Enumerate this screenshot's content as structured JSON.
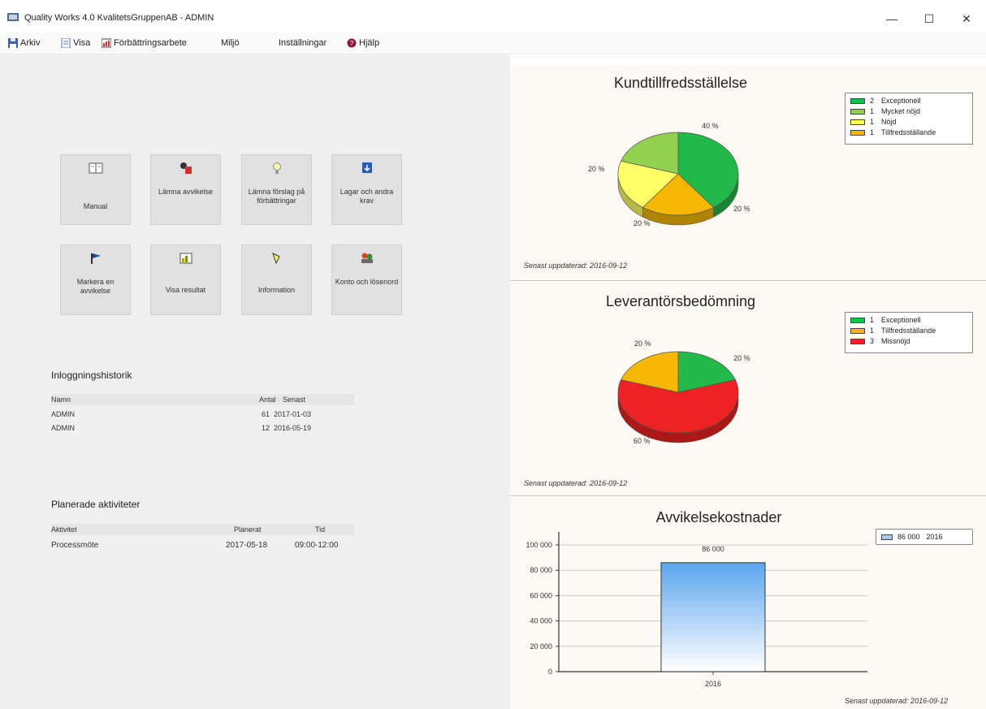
{
  "window": {
    "title": "Quality Works 4.0 KvalitetsGruppenAB - ADMIN",
    "minimize": "—",
    "maximize": "☐",
    "close": "✕"
  },
  "menu": [
    {
      "label": "Arkiv",
      "icon": "save-icon"
    },
    {
      "label": "Visa",
      "icon": "document-icon"
    },
    {
      "label": "Förbättringsarbete",
      "icon": "chart-icon"
    },
    {
      "label": "Miljö",
      "icon": ""
    },
    {
      "label": "Inställningar",
      "icon": ""
    },
    {
      "label": "Hjälp",
      "icon": "help-icon"
    }
  ],
  "tiles": [
    {
      "label": "Manual",
      "icon": "book-icon"
    },
    {
      "label": "Lämna avvikelse",
      "icon": "report-icon"
    },
    {
      "label": "Lämna förslag på förbättringar",
      "icon": "lightbulb-icon"
    },
    {
      "label": "Lagar och andra krav",
      "icon": "download-icon"
    },
    {
      "label": "Markera en avvikelse",
      "icon": "flag-icon"
    },
    {
      "label": "Visa resultat",
      "icon": "results-icon"
    },
    {
      "label": "Information",
      "icon": "info-icon"
    },
    {
      "label": "Konto och lösenord",
      "icon": "users-icon"
    }
  ],
  "login_history": {
    "title": "Inloggningshistorik",
    "headers": {
      "name": "Namn",
      "count": "Antal",
      "last": "Senast"
    },
    "rows": [
      {
        "name": "ADMIN",
        "count": "61",
        "last": "2017-01-03"
      },
      {
        "name": "ADMIN",
        "count": "12",
        "last": "2016-05-19"
      }
    ]
  },
  "planned": {
    "title": "Planerade aktiviteter",
    "headers": {
      "activity": "Aktivitet",
      "planned": "Planerat",
      "time": "Tid"
    },
    "rows": [
      {
        "activity": "Processmöte",
        "planned": "2017-05-18",
        "time": "09:00-12:00"
      }
    ]
  },
  "chart_data": [
    {
      "type": "pie",
      "title": "Kundtillfredsställelse",
      "slices": [
        {
          "label": "Exceptionell",
          "count": 2,
          "percent": 40,
          "percent_label": "40 %",
          "color": "#22b84a"
        },
        {
          "label": "Tillfredsställande",
          "count": 1,
          "percent": 20,
          "percent_label": "20 %",
          "color": "#f5b800"
        },
        {
          "label": "Nöjd",
          "count": 1,
          "percent": 20,
          "percent_label": "20 %",
          "color": "#ffff66"
        },
        {
          "label": "Mycket nöjd",
          "count": 1,
          "percent": 20,
          "percent_label": "20 %",
          "color": "#92d050"
        }
      ],
      "legend": [
        {
          "count": "2",
          "label": "Exceptionell",
          "color": "#22b84a"
        },
        {
          "count": "1",
          "label": "Mycket nöjd",
          "color": "#92d050"
        },
        {
          "count": "1",
          "label": "Nöjd",
          "color": "#ffff66"
        },
        {
          "count": "1",
          "label": "Tillfredsställande",
          "color": "#f5b800"
        }
      ],
      "legend_position": "top-right",
      "updated": "Senast uppdaterad: 2016-09-12"
    },
    {
      "type": "pie",
      "title": "Leverantörsbedömning",
      "slices": [
        {
          "label": "Exceptionell",
          "count": 1,
          "percent": 20,
          "percent_label": "20 %",
          "color": "#22b84a"
        },
        {
          "label": "Missnöjd",
          "count": 3,
          "percent": 60,
          "percent_label": "60 %",
          "color": "#ee2222"
        },
        {
          "label": "Tillfredsställande",
          "count": 1,
          "percent": 20,
          "percent_label": "20 %",
          "color": "#f5b800"
        }
      ],
      "legend": [
        {
          "count": "1",
          "label": "Exceptionell",
          "color": "#22b84a"
        },
        {
          "count": "1",
          "label": "Tillfredsställande",
          "color": "#f5b800"
        },
        {
          "count": "3",
          "label": "Missnöjd",
          "color": "#ee2222"
        }
      ],
      "legend_position": "top-right",
      "updated": "Senast uppdaterad: 2016-09-12"
    },
    {
      "type": "bar",
      "title": "Avvikelsekostnader",
      "categories": [
        "2016"
      ],
      "values": [
        86000
      ],
      "value_labels": [
        "86 000"
      ],
      "ylim": [
        0,
        100000
      ],
      "yticks": [
        "0",
        "20 000",
        "40 000",
        "60 000",
        "80 000",
        "100 000"
      ],
      "ytick_values": [
        0,
        20000,
        40000,
        60000,
        80000,
        100000
      ],
      "grid": true,
      "legend": [
        {
          "value": "86 000",
          "label": "2016"
        }
      ],
      "legend_position": "top-right",
      "updated": "Senast uppdaterad: 2016-09-12"
    }
  ]
}
